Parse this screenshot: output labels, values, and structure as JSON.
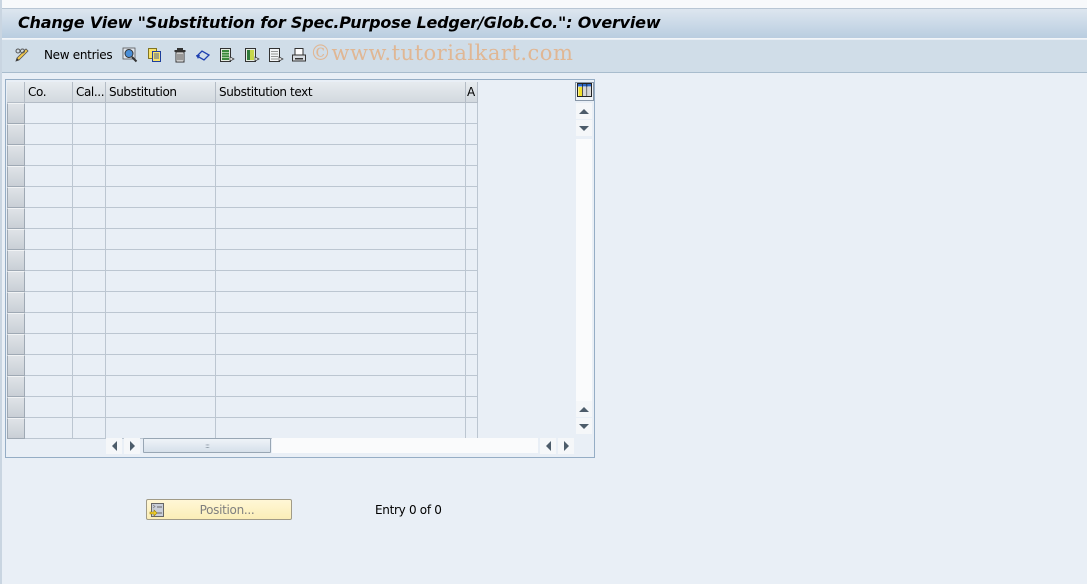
{
  "window": {
    "title": "Change View \"Substitution for Spec.Purpose Ledger/Glob.Co.\": Overview"
  },
  "toolbar": {
    "items": [
      {
        "icon": "pencil-glasses-icon",
        "label": "New entries"
      },
      {
        "icon": "details-magnifier-icon",
        "label": ""
      },
      {
        "icon": "copy-as-icon",
        "label": ""
      },
      {
        "icon": "delete-trash-icon",
        "label": ""
      },
      {
        "icon": "undo-change-icon",
        "label": ""
      },
      {
        "icon": "select-all-icon",
        "label": ""
      },
      {
        "icon": "select-block-icon",
        "label": ""
      },
      {
        "icon": "deselect-all-icon",
        "label": ""
      },
      {
        "icon": "print-icon",
        "label": ""
      }
    ]
  },
  "watermark": "©www.tutorialkart.com",
  "table": {
    "columns": [
      "Co.",
      "Cal...",
      "Substitution",
      "Substitution text",
      "A"
    ],
    "rows": [
      [
        "",
        "",
        "",
        "",
        ""
      ],
      [
        "",
        "",
        "",
        "",
        ""
      ],
      [
        "",
        "",
        "",
        "",
        ""
      ],
      [
        "",
        "",
        "",
        "",
        ""
      ],
      [
        "",
        "",
        "",
        "",
        ""
      ],
      [
        "",
        "",
        "",
        "",
        ""
      ],
      [
        "",
        "",
        "",
        "",
        ""
      ],
      [
        "",
        "",
        "",
        "",
        ""
      ],
      [
        "",
        "",
        "",
        "",
        ""
      ],
      [
        "",
        "",
        "",
        "",
        ""
      ],
      [
        "",
        "",
        "",
        "",
        ""
      ],
      [
        "",
        "",
        "",
        "",
        ""
      ],
      [
        "",
        "",
        "",
        "",
        ""
      ],
      [
        "",
        "",
        "",
        "",
        ""
      ],
      [
        "",
        "",
        "",
        "",
        ""
      ],
      [
        "",
        "",
        "",
        "",
        ""
      ]
    ],
    "hscroll_grip": ":::"
  },
  "footer": {
    "position_button": "Position...",
    "entry_info": "Entry 0 of 0"
  },
  "colors": {
    "background": "#e9eff6",
    "titlebar": "#b9cde0",
    "toolbar": "#d0dde8",
    "position_button": "#fbeeb7"
  }
}
